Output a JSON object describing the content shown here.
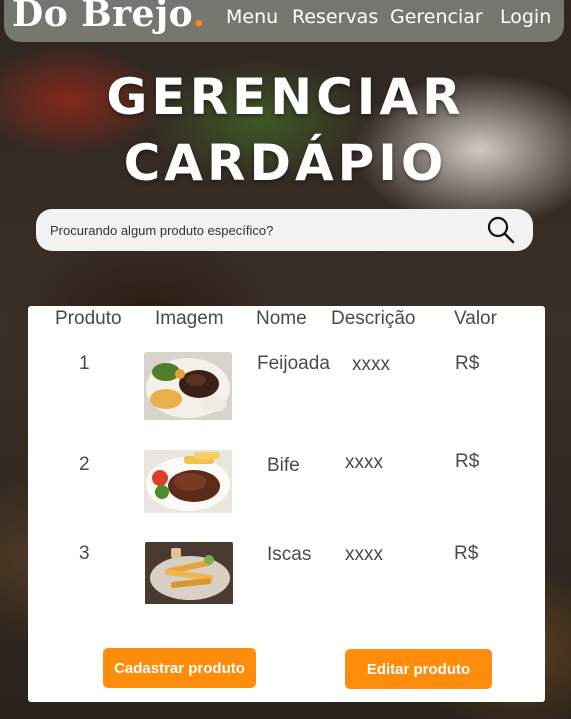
{
  "nav": {
    "logo_text": "Do Brejo",
    "logo_dot": ".",
    "links": [
      "Menu",
      "Reservas",
      "Gerenciar",
      "Login"
    ]
  },
  "page": {
    "title_line1": "GERENCIAR",
    "title_line2": "CARDÁPIO"
  },
  "search": {
    "placeholder": "Procurando algum produto específico?",
    "icon": "search-icon"
  },
  "table": {
    "headers": [
      "Produto",
      "Imagem",
      "Nome",
      "Descrição",
      "Valor"
    ],
    "rows": [
      {
        "produto": "1",
        "image": "feijoada-image",
        "nome": "Feijoada",
        "descricao": "xxxx",
        "valor": "R$"
      },
      {
        "produto": "2",
        "image": "bife-image",
        "nome": "Bife",
        "descricao": "xxxx",
        "valor": "R$"
      },
      {
        "produto": "3",
        "image": "iscas-image",
        "nome": "Iscas",
        "descricao": "xxxx",
        "valor": "R$"
      }
    ]
  },
  "actions": {
    "cadastrar_label": "Cadastrar produto",
    "editar_label": "Editar produto"
  },
  "colors": {
    "accent": "#ff8c0a",
    "logo_dot": "#ff8a00"
  }
}
